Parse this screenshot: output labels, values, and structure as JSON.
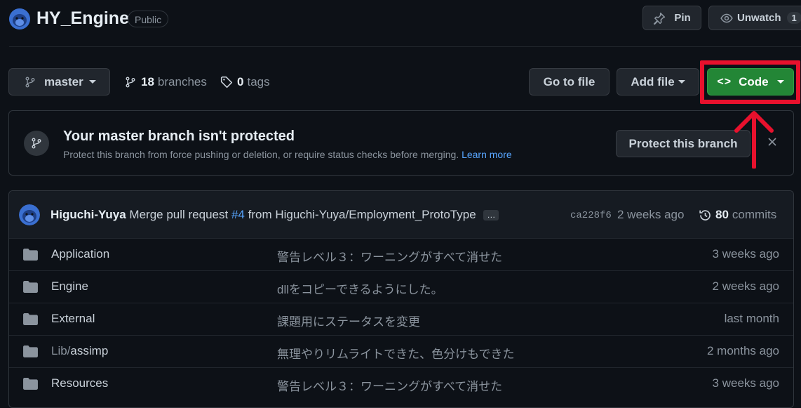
{
  "repo": {
    "name": "HY_Engine",
    "visibility": "Public",
    "pin_label": "Pin",
    "unwatch_label": "Unwatch",
    "watch_count": "1"
  },
  "toolbar": {
    "branch": "master",
    "branches_count": "18",
    "branches_label": "branches",
    "tags_count": "0",
    "tags_label": "tags",
    "go_to_file": "Go to file",
    "add_file": "Add file",
    "code": "Code"
  },
  "protect_banner": {
    "title": "Your master branch isn't protected",
    "description": "Protect this branch from force pushing or deletion, or require status checks before merging.",
    "learn_more": "Learn more",
    "button": "Protect this branch"
  },
  "commit": {
    "author": "Higuchi-Yuya",
    "message_prefix": "Merge pull request",
    "pr_link": "#4",
    "message_suffix": "from Higuchi-Yuya/Employment_ProtoType",
    "ellipsis": "…",
    "sha": "ca228f6",
    "time": "2 weeks ago",
    "commits_count": "80",
    "commits_label": "commits"
  },
  "files": [
    {
      "name": "Application",
      "message": "警告レベル３：ワーニングがすべて消せた",
      "age": "3 weeks ago"
    },
    {
      "name": "Engine",
      "message": "dllをコピーできるようにした。",
      "age": "2 weeks ago"
    },
    {
      "name": "External",
      "message": "課題用にステータスを変更",
      "age": "last month"
    },
    {
      "name_prefix": "Lib/",
      "name": "assimp",
      "message": "無理やりリムライトできた、色分けもできた",
      "age": "2 months ago"
    },
    {
      "name": "Resources",
      "message": "警告レベル３：ワーニングがすべて消せた",
      "age": "3 weeks ago"
    }
  ],
  "colors": {
    "background": "#0d1117",
    "button": "#21262d",
    "code_button": "#238636",
    "link": "#58a6ff",
    "annotation": "#e8112d"
  }
}
